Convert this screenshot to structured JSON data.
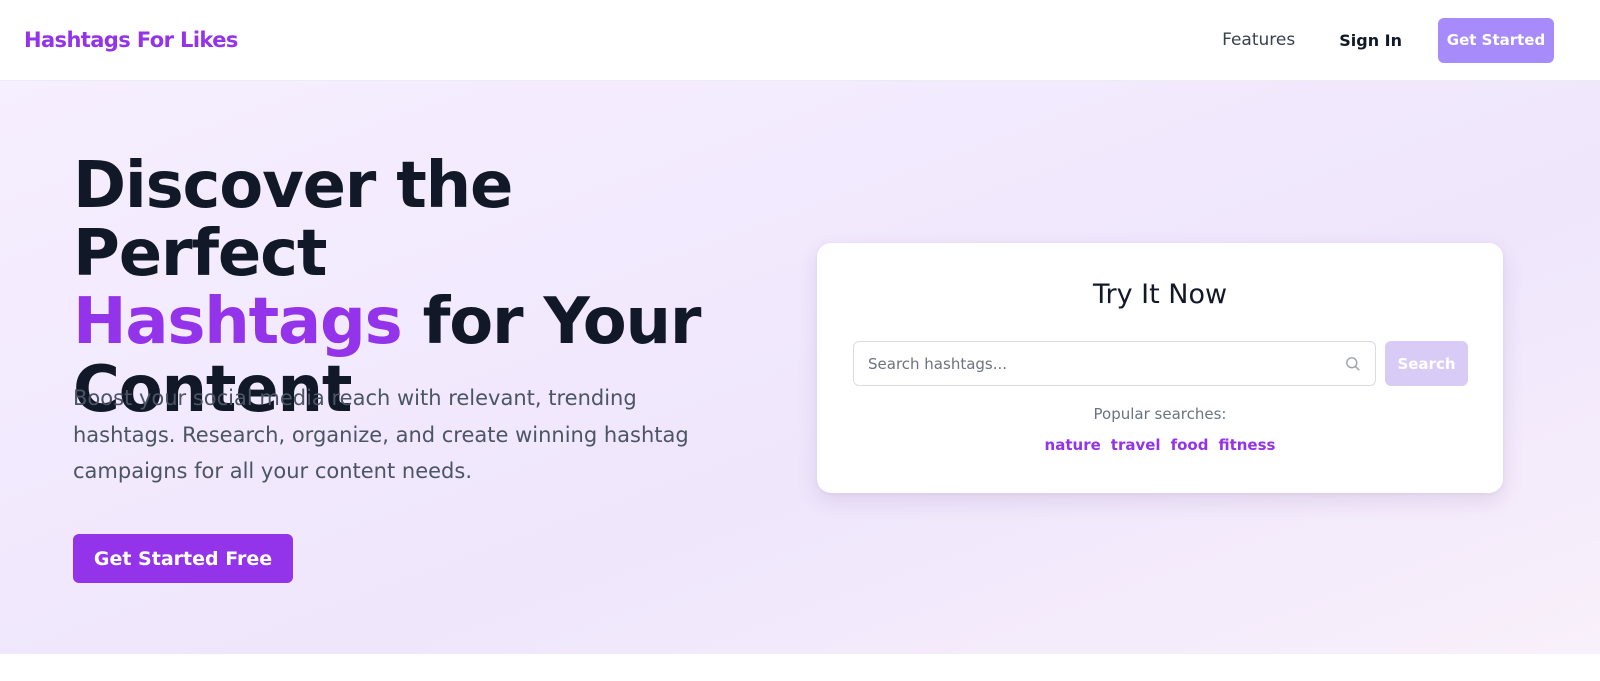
{
  "header": {
    "logo": "Hashtags For Likes",
    "nav": {
      "features": "Features",
      "sign_in": "Sign In",
      "get_started": "Get Started"
    }
  },
  "hero": {
    "headline_line1": "Discover the Perfect",
    "headline_accent": "Hashtags",
    "headline_line2_rest": " for Your",
    "headline_line3": "Content",
    "subtitle": "Boost your social media reach with relevant, trending hashtags. Research, organize, and create winning hashtag campaigns for all your content needs.",
    "cta": "Get Started Free"
  },
  "try_card": {
    "title": "Try It Now",
    "search_placeholder": "Search hashtags...",
    "search_value": "",
    "search_button": "Search",
    "popular_label": "Popular searches:",
    "popular_tags": [
      "nature",
      "travel",
      "food",
      "fitness"
    ]
  },
  "colors": {
    "brand": "#9333ea",
    "nav_cta": "#a78bfa",
    "search_button_disabled": "#d8ccf7"
  },
  "icons": {
    "search": "search-icon"
  }
}
